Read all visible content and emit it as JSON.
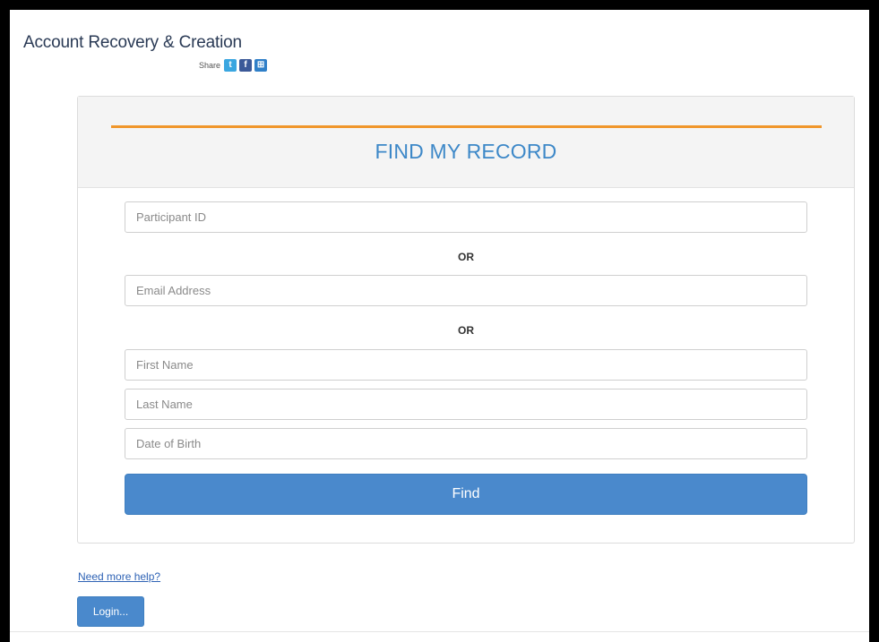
{
  "page": {
    "title": "Account Recovery & Creation"
  },
  "share": {
    "label": "Share",
    "buttons": [
      {
        "icon": "twitter-icon",
        "glyph": "t"
      },
      {
        "icon": "facebook-icon",
        "glyph": "f"
      },
      {
        "icon": "share-grid-icon",
        "glyph": "⊞"
      }
    ]
  },
  "panel": {
    "title": "FIND MY RECORD",
    "accent_color": "#f0962b",
    "title_color": "#3d88c8"
  },
  "form": {
    "participant_id_placeholder": "Participant ID",
    "or_label": "OR",
    "email_placeholder": "Email Address",
    "or_label_2": "OR",
    "first_name_placeholder": "First Name",
    "last_name_placeholder": "Last Name",
    "dob_placeholder": "Date of Birth",
    "find_label": "Find",
    "button_color": "#4a89cc"
  },
  "footer": {
    "help_link": "Need more help?",
    "login_label": "Login..."
  }
}
